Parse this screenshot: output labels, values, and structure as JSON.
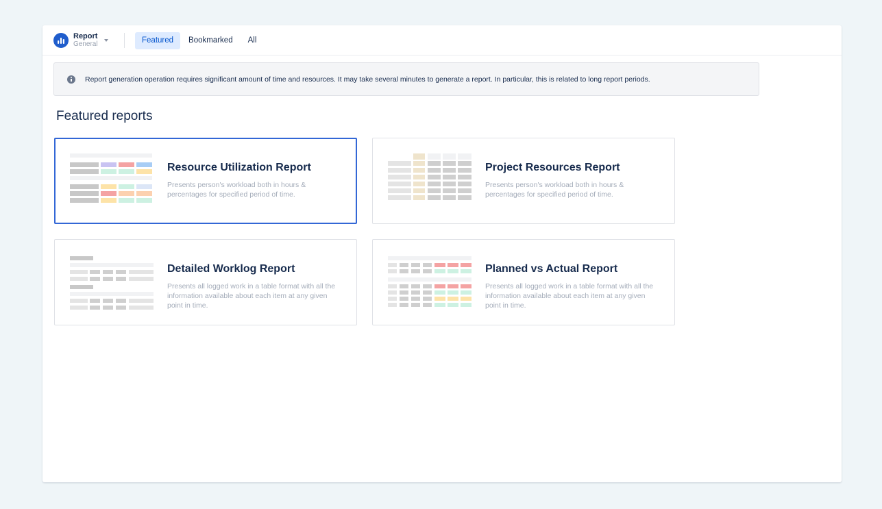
{
  "app": {
    "name": "Report",
    "subtitle": "General"
  },
  "tabs": [
    {
      "label": "Featured",
      "active": true
    },
    {
      "label": "Bookmarked",
      "active": false
    },
    {
      "label": "All",
      "active": false
    }
  ],
  "notice": {
    "text": "Report generation operation requires significant amount of time and resources. It may take several minutes to generate a report. In particular, this is related to long report periods.",
    "icon": "info-icon"
  },
  "featured": {
    "title": "Featured reports",
    "cards": [
      {
        "title": "Resource Utilization Report",
        "description": "Presents person's workload both in hours & percentages for specified period of time.",
        "selected": true,
        "thumbnail": "resource-utilization-thumbnail"
      },
      {
        "title": "Project Resources Report",
        "description": "Presents person's workload both in hours & percentages for specified period of time.",
        "selected": false,
        "thumbnail": "project-resources-thumbnail"
      },
      {
        "title": "Detailed Worklog Report",
        "description": "Presents all logged work in a table format with all the information available about each item at any given point in time.",
        "selected": false,
        "thumbnail": "detailed-worklog-thumbnail"
      },
      {
        "title": "Planned vs Actual Report",
        "description": "Presents all logged work in a table format with all the information available about each item at any given point in time.",
        "selected": false,
        "thumbnail": "planned-vs-actual-thumbnail"
      }
    ]
  },
  "colors": {
    "accent": "#0052cc",
    "selected_border": "#3367d6",
    "page_background": "#eff5f8"
  }
}
